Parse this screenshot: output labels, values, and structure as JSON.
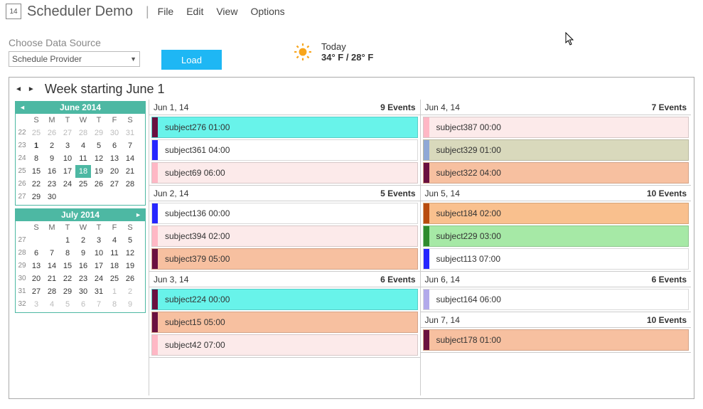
{
  "header": {
    "title": "Scheduler Demo",
    "logo_glyph": "14",
    "menu": [
      "File",
      "Edit",
      "View",
      "Options"
    ]
  },
  "datasource": {
    "label": "Choose Data Source",
    "selected": "Schedule Provider",
    "load_label": "Load"
  },
  "weather": {
    "today": "Today",
    "temp": "34° F / 28° F"
  },
  "week": {
    "prev_glyph": "◄",
    "next_glyph": "►",
    "title": "Week starting June 1"
  },
  "minicals": [
    {
      "title": "June 2014",
      "dow": [
        "S",
        "M",
        "T",
        "W",
        "T",
        "F",
        "S"
      ],
      "rows": [
        {
          "wk": "22",
          "days": [
            {
              "n": "25",
              "o": true
            },
            {
              "n": "26",
              "o": true
            },
            {
              "n": "27",
              "o": true
            },
            {
              "n": "28",
              "o": true
            },
            {
              "n": "29",
              "o": true
            },
            {
              "n": "30",
              "o": true
            },
            {
              "n": "31",
              "o": true
            }
          ]
        },
        {
          "wk": "23",
          "days": [
            {
              "n": "1",
              "today": true
            },
            {
              "n": "2"
            },
            {
              "n": "3"
            },
            {
              "n": "4"
            },
            {
              "n": "5"
            },
            {
              "n": "6"
            },
            {
              "n": "7"
            }
          ]
        },
        {
          "wk": "24",
          "days": [
            {
              "n": "8"
            },
            {
              "n": "9"
            },
            {
              "n": "10"
            },
            {
              "n": "11"
            },
            {
              "n": "12"
            },
            {
              "n": "13"
            },
            {
              "n": "14"
            }
          ]
        },
        {
          "wk": "25",
          "days": [
            {
              "n": "15"
            },
            {
              "n": "16"
            },
            {
              "n": "17"
            },
            {
              "n": "18",
              "sel": true
            },
            {
              "n": "19"
            },
            {
              "n": "20"
            },
            {
              "n": "21"
            }
          ]
        },
        {
          "wk": "26",
          "days": [
            {
              "n": "22"
            },
            {
              "n": "23"
            },
            {
              "n": "24"
            },
            {
              "n": "25"
            },
            {
              "n": "26"
            },
            {
              "n": "27"
            },
            {
              "n": "28"
            }
          ]
        },
        {
          "wk": "27",
          "days": [
            {
              "n": "29"
            },
            {
              "n": "30"
            },
            {
              "n": "",
              "o": true
            },
            {
              "n": "",
              "o": true
            },
            {
              "n": "",
              "o": true
            },
            {
              "n": "",
              "o": true
            },
            {
              "n": "",
              "o": true
            }
          ]
        }
      ]
    },
    {
      "title": "July 2014",
      "dow": [
        "S",
        "M",
        "T",
        "W",
        "T",
        "F",
        "S"
      ],
      "rows": [
        {
          "wk": "27",
          "days": [
            {
              "n": "",
              "o": true
            },
            {
              "n": "",
              "o": true
            },
            {
              "n": "1"
            },
            {
              "n": "2"
            },
            {
              "n": "3"
            },
            {
              "n": "4"
            },
            {
              "n": "5"
            }
          ]
        },
        {
          "wk": "28",
          "days": [
            {
              "n": "6"
            },
            {
              "n": "7"
            },
            {
              "n": "8"
            },
            {
              "n": "9"
            },
            {
              "n": "10"
            },
            {
              "n": "11"
            },
            {
              "n": "12"
            }
          ]
        },
        {
          "wk": "29",
          "days": [
            {
              "n": "13"
            },
            {
              "n": "14"
            },
            {
              "n": "15"
            },
            {
              "n": "16"
            },
            {
              "n": "17"
            },
            {
              "n": "18"
            },
            {
              "n": "19"
            }
          ]
        },
        {
          "wk": "30",
          "days": [
            {
              "n": "20"
            },
            {
              "n": "21"
            },
            {
              "n": "22"
            },
            {
              "n": "23"
            },
            {
              "n": "24"
            },
            {
              "n": "25"
            },
            {
              "n": "26"
            }
          ]
        },
        {
          "wk": "31",
          "days": [
            {
              "n": "27"
            },
            {
              "n": "28"
            },
            {
              "n": "29"
            },
            {
              "n": "30"
            },
            {
              "n": "31"
            },
            {
              "n": "1",
              "o": true
            },
            {
              "n": "2",
              "o": true
            }
          ]
        },
        {
          "wk": "32",
          "days": [
            {
              "n": "3",
              "o": true
            },
            {
              "n": "4",
              "o": true
            },
            {
              "n": "5",
              "o": true
            },
            {
              "n": "6",
              "o": true
            },
            {
              "n": "7",
              "o": true
            },
            {
              "n": "8",
              "o": true
            },
            {
              "n": "9",
              "o": true
            }
          ]
        }
      ]
    }
  ],
  "colors": {
    "cyan_bg": "#68f3ea",
    "cyan_stripe": "#6a1040",
    "pink_bg": "#fceaea",
    "pink_stripe": "#ffb7c5",
    "white_bg": "#ffffff",
    "blue_stripe": "#2626ff",
    "peach_bg": "#f7c0a0",
    "peach_stripe": "#6a1040",
    "olive_bg": "#d9d9bc",
    "olive_stripe": "#8fa8d6",
    "orange_bg": "#f9c08e",
    "orange_stripe": "#b84b0e",
    "green_bg": "#a6e9a6",
    "green_stripe": "#2e8b2e",
    "lav_stripe": "#b2a9ea"
  },
  "columns": [
    [
      {
        "date": "Jun 1, 14",
        "count": "9 Events",
        "events": [
          {
            "label": "subject276 01:00",
            "bg": "cyan_bg",
            "stripe": "cyan_stripe"
          },
          {
            "label": "subject361 04:00",
            "bg": "white_bg",
            "stripe": "blue_stripe"
          },
          {
            "label": "subject69 06:00",
            "bg": "pink_bg",
            "stripe": "pink_stripe"
          }
        ]
      },
      {
        "date": "Jun 2, 14",
        "count": "5 Events",
        "events": [
          {
            "label": "subject136 00:00",
            "bg": "white_bg",
            "stripe": "blue_stripe"
          },
          {
            "label": "subject394 02:00",
            "bg": "pink_bg",
            "stripe": "pink_stripe"
          },
          {
            "label": "subject379 05:00",
            "bg": "peach_bg",
            "stripe": "peach_stripe"
          }
        ]
      },
      {
        "date": "Jun 3, 14",
        "count": "6 Events",
        "events": [
          {
            "label": "subject224 00:00",
            "bg": "cyan_bg",
            "stripe": "cyan_stripe"
          },
          {
            "label": "subject15 05:00",
            "bg": "peach_bg",
            "stripe": "peach_stripe"
          },
          {
            "label": "subject42 07:00",
            "bg": "pink_bg",
            "stripe": "pink_stripe"
          }
        ]
      }
    ],
    [
      {
        "date": "Jun 4, 14",
        "count": "7 Events",
        "events": [
          {
            "label": "subject387 00:00",
            "bg": "pink_bg",
            "stripe": "pink_stripe"
          },
          {
            "label": "subject329 01:00",
            "bg": "olive_bg",
            "stripe": "olive_stripe"
          },
          {
            "label": "subject322 04:00",
            "bg": "peach_bg",
            "stripe": "peach_stripe"
          }
        ]
      },
      {
        "date": "Jun 5, 14",
        "count": "10 Events",
        "events": [
          {
            "label": "subject184 02:00",
            "bg": "orange_bg",
            "stripe": "orange_stripe"
          },
          {
            "label": "subject229 03:00",
            "bg": "green_bg",
            "stripe": "green_stripe"
          },
          {
            "label": "subject113 07:00",
            "bg": "white_bg",
            "stripe": "blue_stripe"
          }
        ]
      },
      {
        "date": "Jun 6, 14",
        "count": "6 Events",
        "events": [
          {
            "label": "subject164 06:00",
            "bg": "white_bg",
            "stripe": "lav_stripe"
          }
        ]
      },
      {
        "date": "Jun 7, 14",
        "count": "10 Events",
        "events": [
          {
            "label": "subject178 01:00",
            "bg": "peach_bg",
            "stripe": "peach_stripe"
          }
        ]
      }
    ]
  ]
}
